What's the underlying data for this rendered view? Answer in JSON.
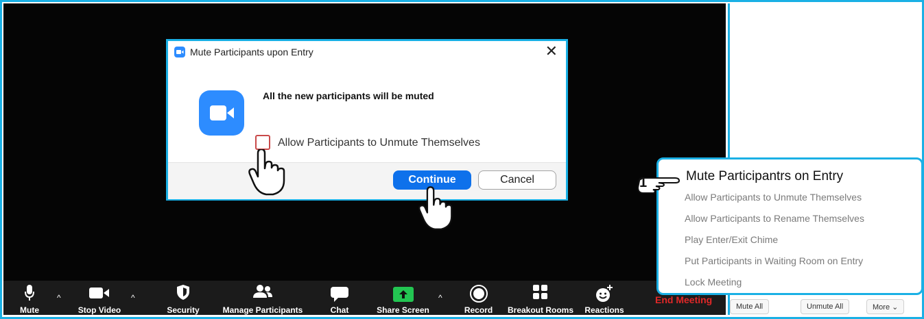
{
  "dialog": {
    "title": "Mute Participants upon Entry",
    "close_glyph": "✕",
    "message": "All the new participants will be muted",
    "checkbox_label": "Allow Participants to Unmute Themselves",
    "continue_label": "Continue",
    "cancel_label": "Cancel"
  },
  "toolbar": {
    "mute": "Mute",
    "stop_video": "Stop Video",
    "security": "Security",
    "manage_participants": "Manage Participants",
    "chat": "Chat",
    "share_screen": "Share Screen",
    "record": "Record",
    "breakout_rooms": "Breakout Rooms",
    "reactions": "Reactions",
    "end_meeting": "End Meeting",
    "caret": "^"
  },
  "participants_menu": {
    "step_number": "1",
    "title": "Mute Participantrs on Entry",
    "items": [
      "Allow Participants to Unmute Themselves",
      "Allow Participants to Rename Themselves",
      "Play Enter/Exit Chime",
      "Put Participants in Waiting Room on Entry",
      "Lock Meeting"
    ]
  },
  "participants_panel": {
    "mute_all": "Mute All",
    "unmute_all": "Unmute All",
    "more": "More ⌄"
  },
  "colors": {
    "accent": "#1ab0e5",
    "zoom_blue": "#2d8cff",
    "button_blue": "#0e71eb",
    "end_red": "#e02828",
    "share_green": "#23c552"
  }
}
